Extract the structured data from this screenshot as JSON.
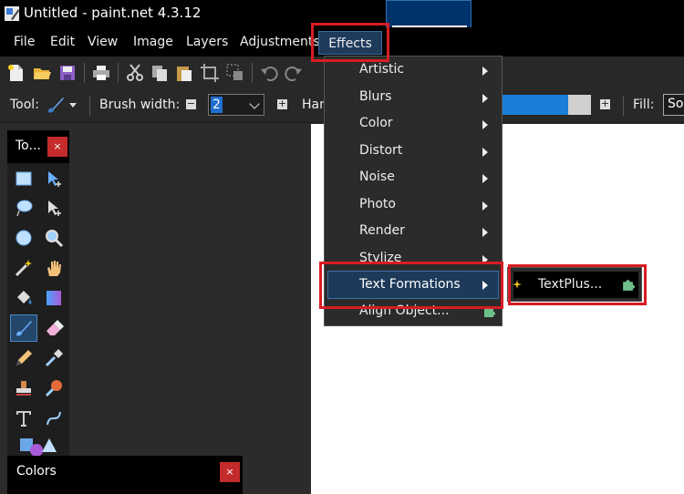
{
  "title_bar": {
    "title": "Untitled - paint.net 4.3.12",
    "icon": "paintnet-app-icon"
  },
  "menu_bar": {
    "items": [
      "File",
      "Edit",
      "View",
      "Image",
      "Layers",
      "Adjustments",
      "Effects"
    ]
  },
  "toolbar": {
    "icons": [
      "new-icon",
      "open-icon",
      "save-icon",
      "print-icon",
      "cut-icon",
      "copy-icon",
      "paste-icon",
      "crop-icon",
      "deselect-icon",
      "undo-icon",
      "redo-icon"
    ]
  },
  "tool_options": {
    "tool_label": "Tool:",
    "brush_width_label": "Brush width:",
    "brush_width_value": "2",
    "hardness_label": "Har",
    "hardness_value": 0.75,
    "fill_label": "Fill:",
    "fill_value": "Sol"
  },
  "tools_panel": {
    "title": "To...",
    "close": "×"
  },
  "colors_panel": {
    "title": "Colors",
    "close": "×"
  },
  "effects_menu": {
    "items": [
      {
        "label": "Artistic",
        "has_submenu": true
      },
      {
        "label": "Blurs",
        "has_submenu": true
      },
      {
        "label": "Color",
        "has_submenu": true
      },
      {
        "label": "Distort",
        "has_submenu": true
      },
      {
        "label": "Noise",
        "has_submenu": true
      },
      {
        "label": "Photo",
        "has_submenu": true
      },
      {
        "label": "Render",
        "has_submenu": true
      },
      {
        "label": "Stylize",
        "has_submenu": true
      },
      {
        "label": "Text Formations",
        "has_submenu": true
      },
      {
        "label": "Align Object...",
        "has_submenu": false,
        "plugin": true
      }
    ],
    "highlighted": "Text Formations"
  },
  "submenu": {
    "items": [
      {
        "label": "TextPlus...",
        "plugin": true
      }
    ]
  },
  "colors": {
    "highlight_red": "#d81c24",
    "accent_blue": "#1a7fd9",
    "menu_bg": "#2b2b2b"
  }
}
